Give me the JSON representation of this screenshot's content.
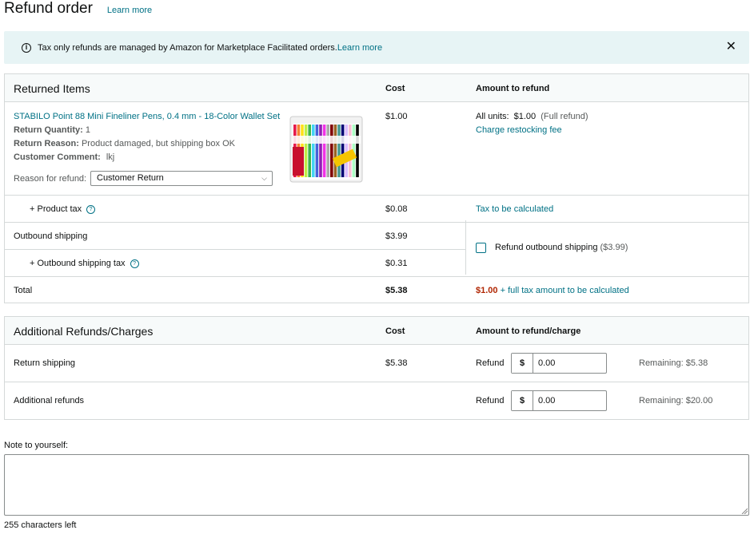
{
  "header": {
    "title": "Refund order",
    "learn_more": "Learn more"
  },
  "banner": {
    "text": "Tax only refunds are managed by Amazon for Marketplace Facilitated orders.",
    "link": "Learn more"
  },
  "returned": {
    "title": "Returned Items",
    "col_cost": "Cost",
    "col_amount": "Amount to refund",
    "item": {
      "name": "STABILO Point 88 Mini Fineliner Pens, 0.4 mm - 18-Color Wallet Set",
      "qty_label": "Return Quantity:",
      "qty": "1",
      "reason_label": "Return Reason:",
      "reason": "Product damaged, but shipping box OK",
      "comment_label": "Customer Comment:",
      "comment": "lkj",
      "refund_reason_label": "Reason for refund:",
      "refund_reason": "Customer Return",
      "cost": "$1.00",
      "all_units_label": "All units:",
      "all_units": "$1.00",
      "full_refund": "(Full refund)",
      "restocking": "Charge restocking fee"
    },
    "product_tax": {
      "label": "+ Product tax",
      "cost": "$0.08",
      "amount": "Tax to be calculated"
    },
    "outbound": {
      "label": "Outbound shipping",
      "cost": "$3.99"
    },
    "outbound_tax": {
      "label": "+ Outbound shipping tax",
      "cost": "$0.31"
    },
    "refund_outbound": {
      "label": "Refund outbound shipping",
      "amount": "($3.99)"
    },
    "total": {
      "label": "Total",
      "cost": "$5.38",
      "amount": "$1.00",
      "suffix": "+ full tax amount to be calculated"
    }
  },
  "additional": {
    "title": "Additional Refunds/Charges",
    "col_cost": "Cost",
    "col_amount": "Amount to refund/charge",
    "rows": [
      {
        "label": "Return shipping",
        "cost": "$5.38",
        "action": "Refund",
        "currency": "$",
        "value": "0.00",
        "remaining": "Remaining: $5.38"
      },
      {
        "label": "Additional refunds",
        "cost": "",
        "action": "Refund",
        "currency": "$",
        "value": "0.00",
        "remaining": "Remaining: $20.00"
      }
    ]
  },
  "note": {
    "label": "Note to yourself:",
    "chars_left": "255 characters left"
  },
  "colors": {
    "link": "#007185",
    "alert_red": "#b12704",
    "banner_bg": "#e7f4f5"
  }
}
